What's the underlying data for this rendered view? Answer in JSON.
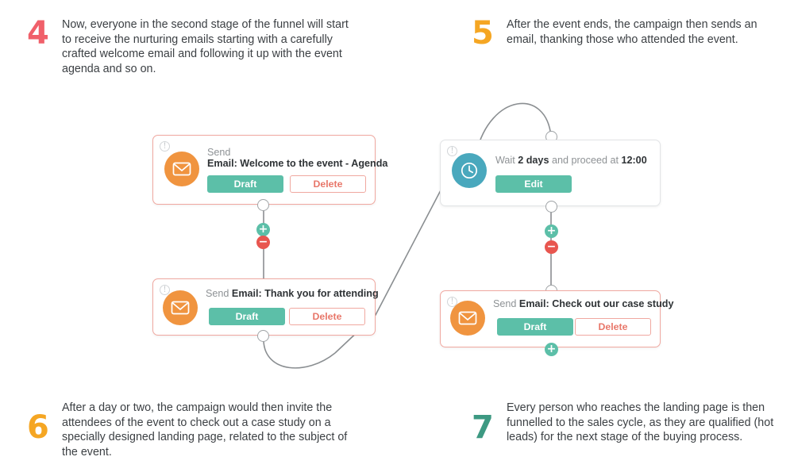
{
  "notes": [
    {
      "number": "4",
      "color": "#f0606a",
      "text": "Now, everyone in the second stage of the funnel will start to receive the nurturing emails starting with a carefully crafted welcome email and following it up with the event agenda and so on."
    },
    {
      "number": "5",
      "color": "#f5a623",
      "text": "After the event ends, the campaign then sends an email, thanking those who attended the event."
    },
    {
      "number": "6",
      "color": "#f5a623",
      "text": "After a day or two, the campaign would then invite the attendees of the event to check out a case study on a specially designed landing page, related to the subject of the event."
    },
    {
      "number": "7",
      "color": "#3d9982",
      "text": "Every person who reaches the landing page is then funnelled to the sales cycle, as they are qualified (hot leads) for the next stage of the buying process."
    }
  ],
  "cards": {
    "welcome_email": {
      "icon": "envelope-icon",
      "info_icon": "info-icon",
      "action_label": "Send",
      "subject": "Email: Welcome to the event - Agenda",
      "primary_button": "Draft",
      "danger_button": "Delete",
      "border_color": "#f0a8a0",
      "avatar_color": "#f0943f"
    },
    "thank_you_email": {
      "icon": "envelope-icon",
      "info_icon": "info-icon",
      "action_label": "Send",
      "subject": "Email: Thank you for attending",
      "primary_button": "Draft",
      "danger_button": "Delete",
      "border_color": "#f0a8a0",
      "avatar_color": "#f0943f"
    },
    "wait_step": {
      "icon": "clock-icon",
      "info_icon": "info-icon",
      "wait_label": "Wait",
      "duration": "2 days",
      "middle_label": "and proceed at",
      "time": "12:00",
      "primary_button": "Edit",
      "border_color": "#e2e4e6",
      "avatar_color": "#49a8bd"
    },
    "case_study_email": {
      "icon": "envelope-icon",
      "info_icon": "info-icon",
      "action_label": "Send",
      "subject": "Email: Check out our case study",
      "primary_button": "Draft",
      "danger_button": "Delete",
      "border_color": "#f0a8a0",
      "avatar_color": "#f0943f"
    }
  },
  "connectors": {
    "add_glyph": "+",
    "remove_glyph": "−",
    "add_color": "#5cbfa8",
    "remove_color": "#e8564f",
    "line_color": "#8a8e91"
  }
}
